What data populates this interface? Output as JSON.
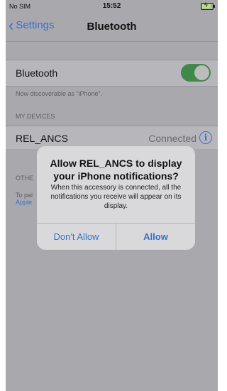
{
  "status_bar": {
    "carrier": "No SIM",
    "time": "15:52",
    "battery_charging": true
  },
  "nav": {
    "back_label": "Settings",
    "title": "Bluetooth"
  },
  "bluetooth": {
    "label": "Bluetooth",
    "enabled": true,
    "discoverable_text": "Now discoverable as “iPhone”."
  },
  "my_devices": {
    "header": "MY DEVICES",
    "items": [
      {
        "name": "REL_ANCS",
        "status": "Connected",
        "icon": "info-icon"
      }
    ]
  },
  "other_devices": {
    "header_partial": "OTHE",
    "line1_partial": "To pai",
    "line2_partial": "Apple"
  },
  "alert": {
    "title": "Allow REL_ANCS to display your iPhone notifications?",
    "message": "When this accessory is connected, all the notifications you receive will appear on its display.",
    "cancel_label": "Don't Allow",
    "confirm_label": "Allow"
  },
  "colors": {
    "accent": "#3a6fcf",
    "toggle_on": "#3f8a4a",
    "dimmed_bg": "#a9a9ad"
  }
}
